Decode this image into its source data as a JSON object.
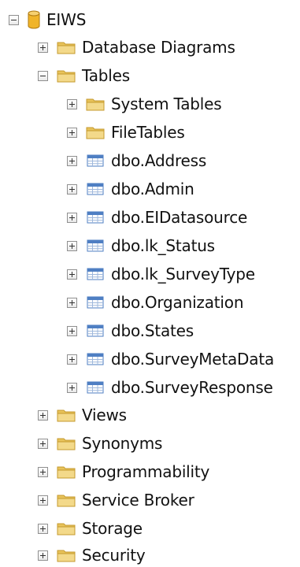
{
  "tree": {
    "root": {
      "label": "EIWS",
      "icon": "database-icon",
      "state": "expanded"
    },
    "nodes": {
      "database_diagrams": "Database Diagrams",
      "tables": "Tables",
      "system_tables": "System Tables",
      "file_tables": "FileTables",
      "t_address": "dbo.Address",
      "t_admin": "dbo.Admin",
      "t_eidatasource": "dbo.EIDatasource",
      "t_lk_status": "dbo.lk_Status",
      "t_lk_surveytype": "dbo.lk_SurveyType",
      "t_organization": "dbo.Organization",
      "t_states": "dbo.States",
      "t_surveymetadata": "dbo.SurveyMetaData",
      "t_surveyresponse": "dbo.SurveyResponse",
      "views": "Views",
      "synonyms": "Synonyms",
      "programmability": "Programmability",
      "service_broker": "Service Broker",
      "storage": "Storage",
      "security": "Security"
    },
    "icons": {
      "folder": "folder-icon",
      "table": "table-icon",
      "database": "database-icon"
    }
  },
  "colors": {
    "folder": "#e8c35a",
    "folder_dark": "#c59a2e",
    "database": "#f0b429",
    "table_header": "#4f7fc3",
    "table_grid": "#9fb8dc"
  }
}
